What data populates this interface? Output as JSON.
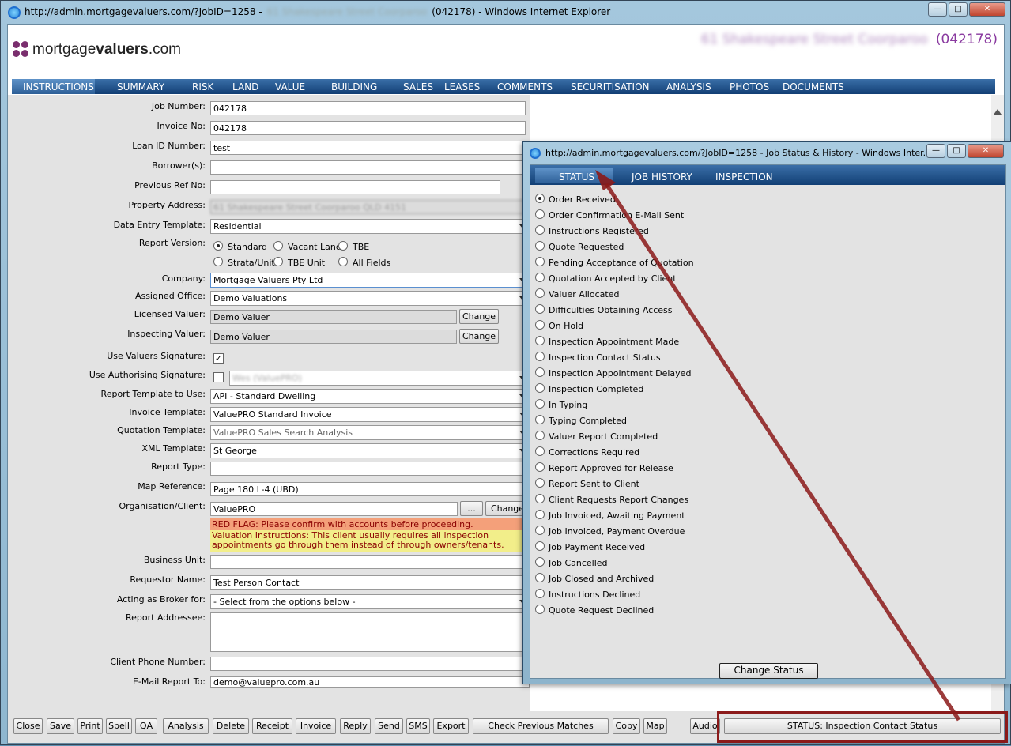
{
  "window": {
    "title_prefix": "http://admin.mortgagevaluers.com/?JobID=1258 -",
    "title_blurred": "61 Shakespeare Street Coorparoo",
    "title_suffix": "(042178) - Windows Internet Explorer",
    "controls": {
      "minimize": "—",
      "maximize": "□",
      "close": "✕"
    }
  },
  "header": {
    "logo_part1": "mortgage",
    "logo_part2": "valuers",
    "logo_part3": ".com",
    "address_blurred": "61 Shakespeare Street Coorparoo",
    "job_ref": "(042178)"
  },
  "nav": [
    "INSTRUCTIONS",
    "SUMMARY",
    "RISK",
    "LAND",
    "VALUE",
    "BUILDING",
    "SALES",
    "LEASES",
    "COMMENTS",
    "SECURITISATION",
    "ANALYSIS",
    "PHOTOS",
    "DOCUMENTS"
  ],
  "form": {
    "job_number": {
      "label": "Job Number:",
      "value": "042178"
    },
    "invoice_no": {
      "label": "Invoice No:",
      "value": "042178"
    },
    "loan_id": {
      "label": "Loan ID Number:",
      "value": "test"
    },
    "borrowers": {
      "label": "Borrower(s):",
      "value": ""
    },
    "previous_ref": {
      "label": "Previous Ref No:",
      "value": ""
    },
    "property_address": {
      "label": "Property Address:",
      "value": "61 Shakespeare Street Coorparoo QLD 4151"
    },
    "data_entry_template": {
      "label": "Data Entry Template:",
      "value": "Residential"
    },
    "report_version": {
      "label": "Report Version:",
      "options": [
        "Standard",
        "Vacant Land",
        "TBE",
        "Strata/Unit",
        "TBE Unit",
        "All Fields"
      ],
      "selected": "Standard"
    },
    "company": {
      "label": "Company:",
      "value": "Mortgage Valuers Pty Ltd"
    },
    "assigned_office": {
      "label": "Assigned Office:",
      "value": "Demo Valuations"
    },
    "licensed_valuer": {
      "label": "Licensed Valuer:",
      "value": "Demo Valuer",
      "button": "Change"
    },
    "inspecting_valuer": {
      "label": "Inspecting Valuer:",
      "value": "Demo Valuer",
      "button": "Change"
    },
    "use_valuers_signature": {
      "label": "Use Valuers Signature:",
      "checked": true
    },
    "use_authorising_signature": {
      "label": "Use Authorising Signature:",
      "checked": false,
      "value": "Wes (ValuePRO)"
    },
    "report_template": {
      "label": "Report Template to Use:",
      "value": "API - Standard Dwelling"
    },
    "invoice_template": {
      "label": "Invoice Template:",
      "value": "ValuePRO Standard Invoice"
    },
    "quotation_template": {
      "label": "Quotation Template:",
      "value": "ValuePRO Sales Search Analysis"
    },
    "xml_template": {
      "label": "XML Template:",
      "value": "St George"
    },
    "report_type": {
      "label": "Report Type:",
      "value": ""
    },
    "map_reference": {
      "label": "Map Reference:",
      "value": "Page 180 L-4 (UBD)"
    },
    "organisation": {
      "label": "Organisation/Client:",
      "value": "ValuePRO",
      "dots": "...",
      "button": "Change"
    },
    "red_flag": "RED FLAG: Please confirm with accounts before proceeding.",
    "valuation_instructions": "Valuation Instructions: This client usually requires all inspection appointments go through them instead of through owners/tenants.",
    "business_unit": {
      "label": "Business Unit:",
      "value": ""
    },
    "requestor_name": {
      "label": "Requestor Name:",
      "value": "Test Person Contact"
    },
    "acting_as_broker": {
      "label": "Acting as Broker for:",
      "value": "- Select from the options below -"
    },
    "report_addressee": {
      "label": "Report Addressee:",
      "value": ""
    },
    "client_phone": {
      "label": "Client Phone Number:",
      "value": ""
    },
    "email_report": {
      "label": "E-Mail Report To:",
      "value": "demo@valuepro.com.au"
    }
  },
  "bottom_buttons": [
    "Close",
    "Save",
    "Print",
    "Spell",
    "QA",
    "Analysis",
    "Delete",
    "Receipt",
    "Invoice",
    "Reply",
    "Send",
    "SMS",
    "Export",
    "Check Previous Matches",
    "Copy",
    "Map",
    "Audio"
  ],
  "status_button": "STATUS: Inspection Contact Status",
  "popup": {
    "title": "http://admin.mortgagevaluers.com/?JobID=1258 - Job Status & History - Windows Inter...",
    "tabs": [
      "STATUS",
      "JOB HISTORY",
      "INSPECTION"
    ],
    "statuses": [
      "Order Received",
      "Order Confirmation E-Mail Sent",
      "Instructions Registered",
      "Quote Requested",
      "Pending Acceptance of Quotation",
      "Quotation Accepted by Client",
      "Valuer Allocated",
      "Difficulties Obtaining Access",
      "On Hold",
      "Inspection Appointment Made",
      "Inspection Contact Status",
      "Inspection Appointment Delayed",
      "Inspection Completed",
      "In Typing",
      "Typing Completed",
      "Valuer Report Completed",
      "Corrections Required",
      "Report Approved for Release",
      "Report Sent to Client",
      "Client Requests Report Changes",
      "Job Invoiced, Awaiting Payment",
      "Job Invoiced, Payment Overdue",
      "Job Payment Received",
      "Job Cancelled",
      "Job Closed and Archived",
      "Instructions Declined",
      "Quote Request Declined"
    ],
    "selected": "Order Received",
    "change_status_button": "Change Status"
  },
  "colors": {
    "nav_bg": "#123f75",
    "red_flag_bg": "#f4a07a",
    "instructions_bg": "#f2ee8a",
    "annotation": "#8b1a1a"
  }
}
